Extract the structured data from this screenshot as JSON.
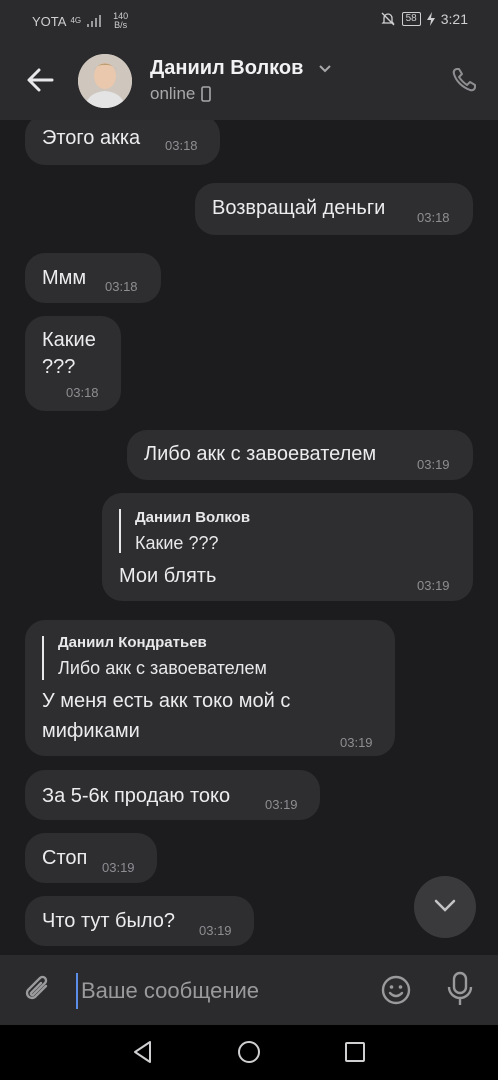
{
  "status_bar": {
    "carrier": "YOTA",
    "network": "4G",
    "speed": "140",
    "speed_unit": "B/s",
    "battery": "58",
    "time": "3:21"
  },
  "header": {
    "name": "Даниил Волков",
    "status": "online"
  },
  "messages": [
    {
      "side": "in",
      "text": "Этого акка",
      "time": "03:18"
    },
    {
      "side": "out",
      "text": "Возвращай деньги",
      "time": "03:18"
    },
    {
      "side": "in",
      "text": "Ммм",
      "time": "03:18"
    },
    {
      "side": "in",
      "text": "Какие",
      "text2": "???",
      "time": "03:18"
    },
    {
      "side": "out",
      "text": "Либо акк с завоевателем",
      "time": "03:19"
    },
    {
      "side": "out",
      "quote_author": "Даниил Волков",
      "quote_text": "Какие ???",
      "text": "Мои блять",
      "time": "03:19"
    },
    {
      "side": "in",
      "quote_author": "Даниил Кондратьев",
      "quote_text": "Либо акк с завоевателем",
      "text": "У меня есть акк токо мой с",
      "text2": "мификами",
      "time": "03:19"
    },
    {
      "side": "in",
      "text": "За 5-6к продаю токо",
      "time": "03:19"
    },
    {
      "side": "in",
      "text": "Стоп",
      "time": "03:19"
    },
    {
      "side": "in",
      "text": "Что тут было?",
      "time": "03:19"
    }
  ],
  "composer": {
    "placeholder": "Ваше сообщение"
  },
  "colors": {
    "background": "#1c1c1e",
    "bubble": "#2e2e31",
    "bar": "#2b2b2d"
  }
}
